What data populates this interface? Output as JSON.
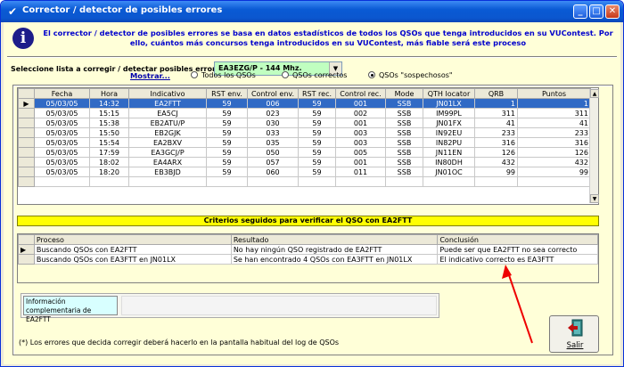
{
  "window": {
    "title": "Corrector / detector de posibles errores",
    "buttons": {
      "minimize": "_",
      "maximize": "□",
      "close": "✕"
    }
  },
  "info": {
    "text": "El corrector / detector de posibles errores se basa en datos estadísticos de todos los QSOs que tenga introducidos en su VUContest. Por ello, cuántos más concursos tenga introducidos en su VUContest, más fiable será este proceso"
  },
  "selector": {
    "label": "Seleccione lista a corregir / detectar posibles errores",
    "value": "EA3EZG/P - 144 Mhz."
  },
  "filter": {
    "label": "Mostrar...",
    "options": [
      {
        "label": "Todos los QSOs",
        "checked": false
      },
      {
        "label": "QSOs correctos",
        "checked": false
      },
      {
        "label": "QSOs \"sospechosos\"",
        "checked": true
      }
    ]
  },
  "qso_table": {
    "columns": [
      "Fecha",
      "Hora",
      "Indicativo",
      "RST env.",
      "Control env.",
      "RST rec.",
      "Control rec.",
      "Mode",
      "QTH locator",
      "QRB",
      "Puntos"
    ],
    "rows": [
      [
        "05/03/05",
        "14:32",
        "EA2FTT",
        "59",
        "006",
        "59",
        "001",
        "SSB",
        "JN01LX",
        "1",
        "1"
      ],
      [
        "05/03/05",
        "15:15",
        "EA5CJ",
        "59",
        "023",
        "59",
        "002",
        "SSB",
        "IM99PL",
        "311",
        "311"
      ],
      [
        "05/03/05",
        "15:38",
        "EB2ATU/P",
        "59",
        "030",
        "59",
        "001",
        "SSB",
        "JN01FX",
        "41",
        "41"
      ],
      [
        "05/03/05",
        "15:50",
        "EB2GJK",
        "59",
        "033",
        "59",
        "003",
        "SSB",
        "IN92EU",
        "233",
        "233"
      ],
      [
        "05/03/05",
        "15:54",
        "EA2BXV",
        "59",
        "035",
        "59",
        "003",
        "SSB",
        "IN82PU",
        "316",
        "316"
      ],
      [
        "05/03/05",
        "17:59",
        "EA3GCJ/P",
        "59",
        "050",
        "59",
        "005",
        "SSB",
        "JN11EN",
        "126",
        "126"
      ],
      [
        "05/03/05",
        "18:02",
        "EA4ARX",
        "59",
        "057",
        "59",
        "001",
        "SSB",
        "IN80DH",
        "432",
        "432"
      ],
      [
        "05/03/05",
        "18:20",
        "EB3BJD",
        "59",
        "060",
        "59",
        "011",
        "SSB",
        "JN01OC",
        "99",
        "99"
      ]
    ],
    "selected_row": 0
  },
  "criteria": {
    "title": "Criterios seguidos para verificar el QSO con EA2FTT",
    "columns": [
      "Proceso",
      "Resultado",
      "Conclusión"
    ],
    "rows": [
      [
        "Buscando QSOs con EA2FTT",
        "No hay ningún QSO registrado de EA2FTT",
        "Puede ser que EA2FTT no sea correcto"
      ],
      [
        "Buscando QSOs con EA3FTT en JN01LX",
        "Se han encontrado 4 QSOs con EA3FTT en JN01LX",
        "El indicativo correcto es EA3FTT"
      ]
    ]
  },
  "complement": {
    "label": "Información complementaria de EA2FTT",
    "value": ""
  },
  "footnote": "(*) Los errores que decida corregir deberá hacerlo en la pantalla habitual del log de QSOs",
  "exit_button": {
    "label": "Salir"
  },
  "colors": {
    "title_bar": "#0a5ad4",
    "info_text": "#0000cc",
    "selected_row": "#316ac5",
    "combo_bg": "#c0ffc0",
    "criteria_bg": "#ffff00",
    "arrow": "#ee0000"
  }
}
